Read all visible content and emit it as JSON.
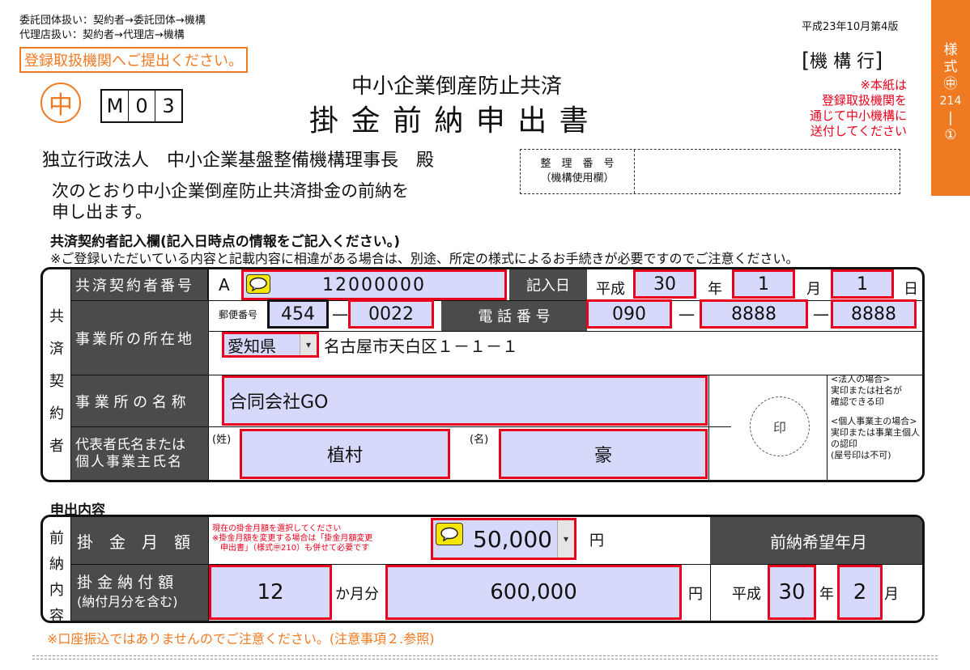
{
  "header": {
    "route1": "委託団体扱い：契約者→委託団体→機構",
    "route2": "代理店扱い：契約者→代理店→機構",
    "submit_notice": "登録取扱機関へご提出ください。",
    "version": "平成23年10月第4版",
    "kikou": "機 構 行",
    "red_note": [
      "※本紙は",
      "登録取扱機関を",
      "通じて中小機構に",
      "送付してください"
    ],
    "naka_mark": "中",
    "code_chars": [
      "M",
      "0",
      "3"
    ],
    "subtitle": "中小企業倒産防止共済",
    "title": "掛 金 前 納 申 出 書",
    "side_tab": [
      "様",
      "式",
      "㊥",
      "214",
      "|",
      "①"
    ]
  },
  "addressee": "独立行政法人　中小企業基盤整備機構理事長　殿",
  "intro_line1": "次のとおり中小企業倒産防止共済掛金の前納を",
  "intro_line2": "申し出ます。",
  "ref_box": {
    "label1": "整　理　番　号",
    "label2": "（機構使用欄）"
  },
  "section1": {
    "heading": "共済契約者記入欄(記入日時点の情報をご記入ください。)",
    "note": "※ご登録いただいている内容と記載内容に相違がある場合は、別途、所定の様式によるお手続きが必要ですのでご注意ください。",
    "side_label": [
      "共",
      "済",
      "契",
      "約",
      "者"
    ],
    "contract_no_label": "共済契約者番号",
    "contract_prefix": "A",
    "contract_no": "12000000",
    "date_label": "記入日",
    "era": "平成",
    "year": "30",
    "year_unit": "年",
    "month": "1",
    "month_unit": "月",
    "day": "1",
    "day_unit": "日",
    "address_label": "事業所の所在地",
    "postal_label": "郵便番号",
    "postal1": "454",
    "postal2": "0022",
    "dash": "—",
    "phone_label": "電 話 番 号",
    "phone1": "090",
    "phone2": "8888",
    "phone3": "8888",
    "prefecture": "愛知県",
    "address": "名古屋市天白区１－１－１",
    "name_label": "事 業 所 の 名 称",
    "company": "合同会社GO",
    "rep_label1": "代表者氏名または",
    "rep_label2": "個人事業主氏名",
    "sei_label": "(姓)",
    "mei_label": "(名)",
    "sei": "植村",
    "mei": "豪",
    "stamp": "印",
    "stamp_note": [
      "<法人の場合>",
      "実印または社名が",
      "確認できる印",
      "",
      "<個人事業主の場合>",
      "実印または事業主個人",
      "の認印",
      "(屋号印は不可)"
    ]
  },
  "section2": {
    "heading": "申出内容",
    "side_label": [
      "前",
      "納",
      "内",
      "容"
    ],
    "monthly_label": "掛　金　月　額",
    "monthly_note1": "現在の掛金月額を選択してください",
    "monthly_note2": "※掛金月額を変更する場合は「掛金月額変更",
    "monthly_note3": "　申出書」（様式㊥210）も併せて必要です",
    "monthly_amount": "50,000",
    "yen": "円",
    "wish_label": "前納希望年月",
    "pay_label1": "掛 金 納 付 額",
    "pay_label2": "(納付月分を含む)",
    "months": "12",
    "months_unit": "か月分",
    "total": "600,000",
    "era": "平成",
    "wish_year": "30",
    "year_unit": "年",
    "wish_month": "2",
    "month_unit": "月"
  },
  "footer_note": "※口座振込ではありませんのでご注意ください。(注意事項２.参照)",
  "colors": {
    "accent": "#f07a22",
    "field_fill": "#d7d9fb",
    "field_border": "#e8001c",
    "header_dark": "#4b4b4b"
  }
}
